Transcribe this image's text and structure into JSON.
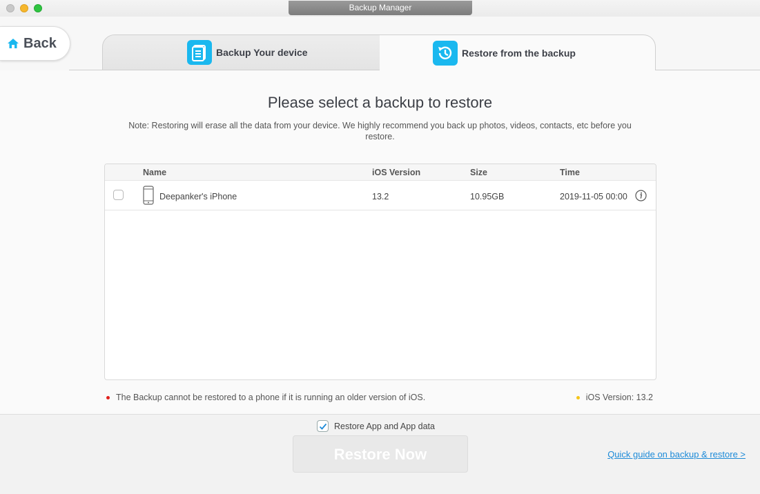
{
  "window": {
    "title": "Backup Manager"
  },
  "nav": {
    "back_label": "Back"
  },
  "tabs": [
    {
      "label": "Backup Your device",
      "active": false
    },
    {
      "label": "Restore from the backup",
      "active": true
    }
  ],
  "main": {
    "heading": "Please select a backup to restore",
    "note": "Note: Restoring will erase all the data from your device. We highly recommend you back up photos, videos, contacts, etc before you restore."
  },
  "table": {
    "columns": [
      "Name",
      "iOS Version",
      "Size",
      "Time"
    ],
    "rows": [
      {
        "name": "Deepanker's iPhone",
        "ios_version": "13.2",
        "size": "10.95GB",
        "time": "2019-11-05 00:00",
        "checked": false
      }
    ]
  },
  "status": {
    "warning": "The Backup cannot be restored to a phone if it is running an older version of iOS.",
    "ios_version": "iOS Version: 13.2"
  },
  "footer": {
    "restore_app_label": "Restore App and App data",
    "restore_app_checked": true,
    "restore_button_label": "Restore Now",
    "guide_link_label": "Quick guide on backup & restore >"
  },
  "colors": {
    "accent": "#1ab8ef",
    "link": "#1c8ad8",
    "warning_dot": "#e0201c",
    "version_dot": "#f5c518"
  },
  "icons": [
    "home-icon",
    "backup-doc-icon",
    "restore-clock-icon",
    "phone-icon",
    "info-icon",
    "checkmark-icon"
  ]
}
